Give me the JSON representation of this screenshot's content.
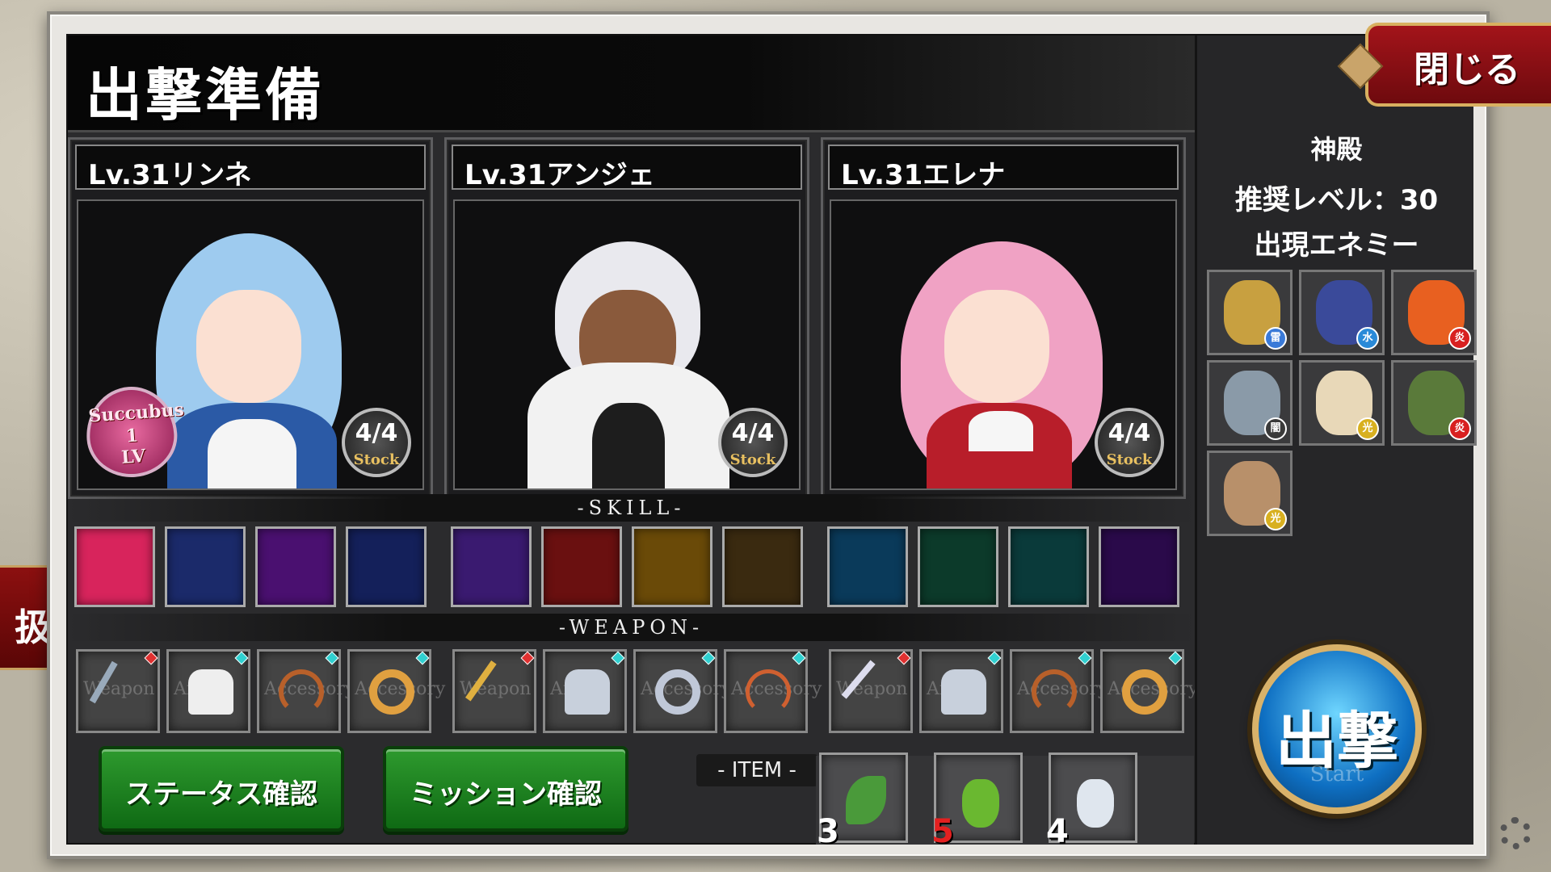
{
  "screen": {
    "title": "出撃準備",
    "close_label": "閉じる",
    "left_tab_char": "扱"
  },
  "stage": {
    "name": "神殿",
    "recommended_level": "推奨レベル：30",
    "enemies_label": "出現エネミー",
    "enemies": [
      {
        "icon": "masked-warrior",
        "attr": "雷"
      },
      {
        "icon": "dark-knight",
        "attr": "水"
      },
      {
        "icon": "phoenix",
        "attr": "炎"
      },
      {
        "icon": "werewolf",
        "attr": "闇"
      },
      {
        "icon": "angel",
        "attr": "光"
      },
      {
        "icon": "goblin",
        "attr": "炎"
      },
      {
        "icon": "old-sage",
        "attr": "光"
      }
    ]
  },
  "characters": [
    {
      "name": "Lv.31リンネ",
      "stock": "4/4",
      "stock_label": "Stock",
      "badge": {
        "title": "Succubus",
        "level": "1",
        "lv": "LV"
      }
    },
    {
      "name": "Lv.31アンジェ",
      "stock": "4/4",
      "stock_label": "Stock"
    },
    {
      "name": "Lv.31エレナ",
      "stock": "4/4",
      "stock_label": "Stock"
    }
  ],
  "sections": {
    "skill": "-SKILL-",
    "weapon": "-WEAPON-",
    "item": "- ITEM -"
  },
  "skills": [
    {
      "icon": "feather-arrow-icon",
      "color": "#d8245c"
    },
    {
      "icon": "golden-orbit-icon",
      "color": "#1b2a6a"
    },
    {
      "icon": "purple-slash-icon",
      "color": "#4a1070"
    },
    {
      "icon": "blue-aura-icon",
      "color": "#14205a"
    },
    {
      "icon": "lightning-orb-icon",
      "color": "#3a1a70"
    },
    {
      "icon": "fire-burst-icon",
      "color": "#6a1010"
    },
    {
      "icon": "golden-sword-icon",
      "color": "#6a4a08"
    },
    {
      "icon": "treasure-chest-icon",
      "color": "#3a2a10"
    },
    {
      "icon": "water-ring-icon",
      "color": "#0a3a5a"
    },
    {
      "icon": "green-wind-icon",
      "color": "#0c3a2a"
    },
    {
      "icon": "triple-arrow-icon",
      "color": "#0a3a3a"
    },
    {
      "icon": "shadow-claw-icon",
      "color": "#2a0a4a"
    }
  ],
  "weapons": [
    {
      "icon": "trident-icon",
      "tag": "Weapon",
      "gem": "#e03030"
    },
    {
      "icon": "white-armor-icon",
      "tag": "Armor",
      "gem": "#30d0d0"
    },
    {
      "icon": "whip-icon",
      "tag": "Accessory",
      "gem": "#30d0d0"
    },
    {
      "icon": "ring-icon",
      "tag": "Accessory",
      "gem": "#30d0d0"
    },
    {
      "icon": "golden-staff-icon",
      "tag": "Weapon",
      "gem": "#e03030"
    },
    {
      "icon": "knight-armor-icon",
      "tag": "Armor",
      "gem": "#30d0d0"
    },
    {
      "icon": "silver-ring-icon",
      "tag": "Accessory",
      "gem": "#30d0d0"
    },
    {
      "icon": "pendant-icon",
      "tag": "Accessory",
      "gem": "#30d0d0"
    },
    {
      "icon": "dagger-icon",
      "tag": "Weapon",
      "gem": "#e03030"
    },
    {
      "icon": "knight-armor-icon",
      "tag": "Armor",
      "gem": "#30d0d0"
    },
    {
      "icon": "whip-icon",
      "tag": "Accessory",
      "gem": "#30d0d0"
    },
    {
      "icon": "gem-ring-icon",
      "tag": "Accessory",
      "gem": "#30d0d0"
    }
  ],
  "buttons": {
    "status": "ステータス確認",
    "mission": "ミッション確認",
    "sortie": "出撃",
    "sortie_sub": "Start"
  },
  "items": [
    {
      "icon": "herb-icon",
      "count": "3",
      "warn": false
    },
    {
      "icon": "green-potion-icon",
      "count": "5",
      "warn": true
    },
    {
      "icon": "white-potion-icon",
      "count": "4",
      "warn": false
    }
  ]
}
